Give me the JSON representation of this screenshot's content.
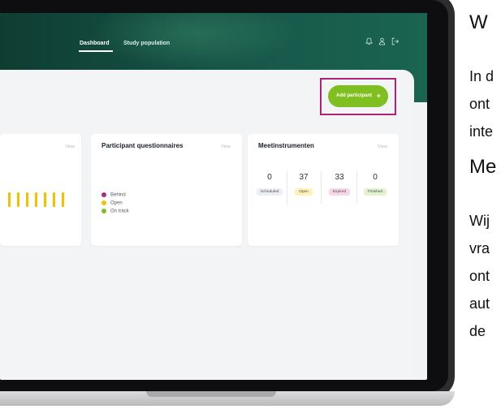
{
  "nav": {
    "tabs": [
      {
        "label": "Dashboard",
        "active": true
      },
      {
        "label": "Study population",
        "active": false
      }
    ],
    "icons": [
      "bell-icon",
      "user-icon",
      "logout-icon"
    ]
  },
  "actions": {
    "add_participant_label": "Add participant",
    "add_participant_icon": "+"
  },
  "cards": {
    "questionnaires": {
      "title": "Participant questionnaires",
      "view_label": "View",
      "legend": [
        {
          "label": "Behind",
          "color": "#b02a7c"
        },
        {
          "label": "Open",
          "color": "#f2c200"
        },
        {
          "label": "On track",
          "color": "#7fbf1f"
        }
      ]
    },
    "instruments": {
      "title": "Meetinstrumenten",
      "view_label": "View",
      "stats": [
        {
          "value": "0",
          "label": "Scheduled",
          "badge_color": "#eceef1"
        },
        {
          "value": "37",
          "label": "Open",
          "badge_color": "#fff2b8"
        },
        {
          "value": "33",
          "label": "Expired",
          "badge_color": "#f9d7e7"
        },
        {
          "value": "0",
          "label": "Finished",
          "badge_color": "#e3f3cf"
        }
      ]
    },
    "chart": {
      "view_label": "View",
      "bar_levels": [
        1,
        1,
        1,
        1,
        1,
        1,
        1
      ],
      "bar_color": "#f2c200"
    }
  },
  "document": {
    "heading1": "W",
    "para1": [
      "In d",
      "ont",
      "inte"
    ],
    "heading2": "Me",
    "para2": [
      "Wij",
      "vra",
      "ont",
      "aut",
      "de "
    ]
  },
  "colors": {
    "header": "#17584a",
    "accent_green": "#7fbf1f",
    "highlight_magenta": "#b0227a"
  }
}
